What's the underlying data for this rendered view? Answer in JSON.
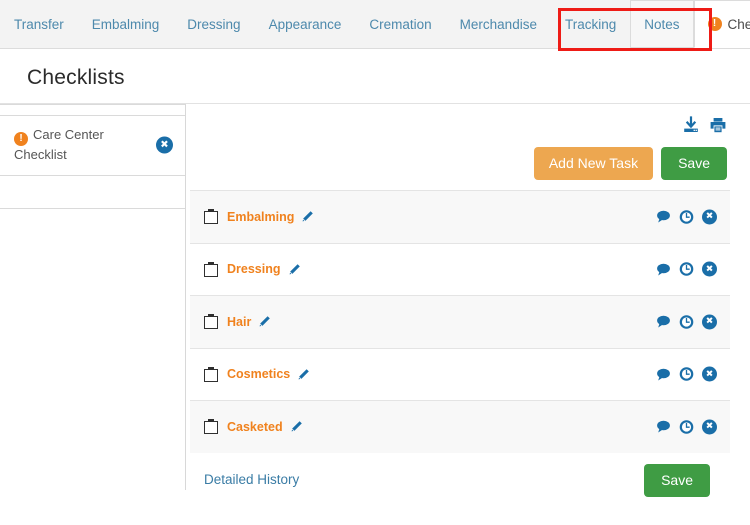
{
  "tabs": [
    {
      "label": "Transfer",
      "state": "normal",
      "warning": false
    },
    {
      "label": "Embalming",
      "state": "normal",
      "warning": false
    },
    {
      "label": "Dressing",
      "state": "normal",
      "warning": false
    },
    {
      "label": "Appearance",
      "state": "normal",
      "warning": false
    },
    {
      "label": "Cremation",
      "state": "normal",
      "warning": false
    },
    {
      "label": "Merchandise",
      "state": "normal",
      "warning": false
    },
    {
      "label": "Tracking",
      "state": "normal",
      "warning": false
    },
    {
      "label": "Notes",
      "state": "boxed",
      "warning": false
    },
    {
      "label": "Checklists",
      "state": "active",
      "warning": true
    }
  ],
  "page": {
    "title": "Checklists"
  },
  "sidebar": {
    "items": [
      {
        "label": "Care Center Checklist",
        "warning": true,
        "delete_label": "✖"
      }
    ]
  },
  "toolbar": {
    "download_icon": "download-icon",
    "print_icon": "print-icon",
    "add_task_label": "Add New Task",
    "save_label": "Save"
  },
  "tasks": [
    {
      "name": "Embalming",
      "checked": false
    },
    {
      "name": "Dressing",
      "checked": false
    },
    {
      "name": "Hair",
      "checked": false
    },
    {
      "name": "Cosmetics",
      "checked": false
    },
    {
      "name": "Casketed",
      "checked": false
    }
  ],
  "row_actions": {
    "comment_icon": "comment-icon",
    "history_icon": "clock-icon",
    "delete_label": "✖"
  },
  "footer": {
    "history_link": "Detailed History",
    "save_label": "Save"
  },
  "colors": {
    "accent_orange": "#f0821e",
    "link_blue": "#4d89ac",
    "icon_blue": "#1a6ea8",
    "save_green": "#3f9c44",
    "add_orange": "#eda750",
    "annotation_red": "#ee1b16"
  }
}
